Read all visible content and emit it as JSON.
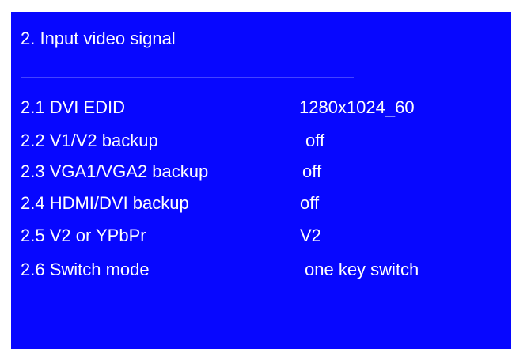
{
  "menu": {
    "title": "2.  Input video signal",
    "divider": "——————————————————————————————",
    "items": [
      {
        "label": "2.1 DVI EDID",
        "value": "1280x1024_60"
      },
      {
        "label": "2.2 V1/V2 backup",
        "value": "off"
      },
      {
        "label": "2.3 VGA1/VGA2 backup",
        "value": "off"
      },
      {
        "label": "2.4 HDMI/DVI backup",
        "value": "off"
      },
      {
        "label": "2.5 V2 or YPbPr",
        "value": "V2"
      },
      {
        "label": "2.6 Switch mode",
        "value": "one key switch"
      }
    ]
  },
  "colors": {
    "background": "#0707ff",
    "text": "#ffffff"
  }
}
